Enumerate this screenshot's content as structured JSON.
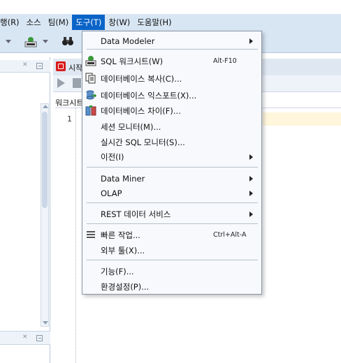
{
  "menubar": {
    "items": [
      {
        "label": "행(R)"
      },
      {
        "label": "소스"
      },
      {
        "label": "팀(M)"
      },
      {
        "label": "도구(T)"
      },
      {
        "label": "창(W)"
      },
      {
        "label": "도움말(H)"
      }
    ],
    "open_index": 3
  },
  "editor": {
    "start_tab_label": "시작",
    "worksheet_tab_label": "워크시트",
    "line_number": "1"
  },
  "tools_menu": {
    "data_modeler": "Data Modeler",
    "sql_worksheet": "SQL 워크시트(W)",
    "sql_worksheet_shortcut": "Alt-F10",
    "db_copy": "데이터베이스 복사(C)...",
    "db_export": "데이터베이스 익스포트(X)...",
    "db_diff": "데이터베이스 차이(F)...",
    "session_monitor": "세션 모니터(M)...",
    "realtime_sql_monitor": "실시간 SQL 모니터(S)...",
    "migration": "이전(I)",
    "data_miner": "Data Miner",
    "olap": "OLAP",
    "rest_data_services": "REST 데이터 서비스",
    "quick_tasks": "빠른 작업...",
    "quick_tasks_shortcut": "Ctrl+Alt-A",
    "external_tools": "외부 툴(X)...",
    "features": "기능(F)...",
    "preferences": "환경설정(P)..."
  },
  "colors": {
    "menubar_bg": "#d8e6f4",
    "menu_highlight": "#0a64c8",
    "dropdown_bg": "#f7f9fc"
  }
}
